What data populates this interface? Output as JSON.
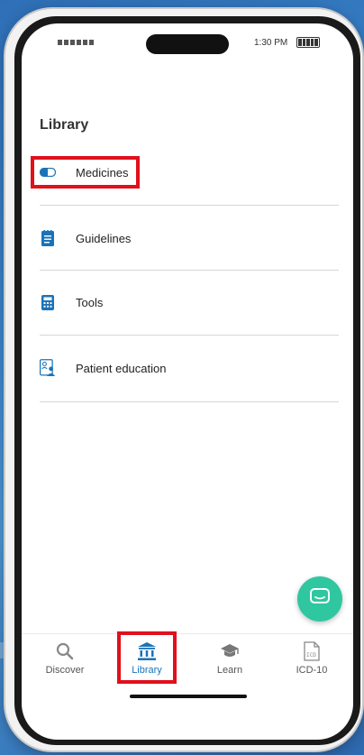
{
  "status_bar": {
    "time": "1:30 PM"
  },
  "library": {
    "title": "Library",
    "items": [
      {
        "label": "Medicines",
        "icon": "pill-icon"
      },
      {
        "label": "Guidelines",
        "icon": "document-icon"
      },
      {
        "label": "Tools",
        "icon": "calculator-icon"
      },
      {
        "label": "Patient education",
        "icon": "patient-card-icon"
      }
    ]
  },
  "fab": {
    "icon": "chat-icon",
    "color": "#2fc7a0"
  },
  "tabbar": {
    "tabs": [
      {
        "label": "Discover",
        "icon": "search-icon",
        "active": false
      },
      {
        "label": "Library",
        "icon": "library-icon",
        "active": true
      },
      {
        "label": "Learn",
        "icon": "graduation-cap-icon",
        "active": false
      },
      {
        "label": "ICD-10",
        "icon": "icd-document-icon",
        "active": false
      }
    ],
    "active_color": "#1a73b8"
  },
  "colors": {
    "accent": "#1a73b8",
    "highlight": "#e0101c"
  }
}
